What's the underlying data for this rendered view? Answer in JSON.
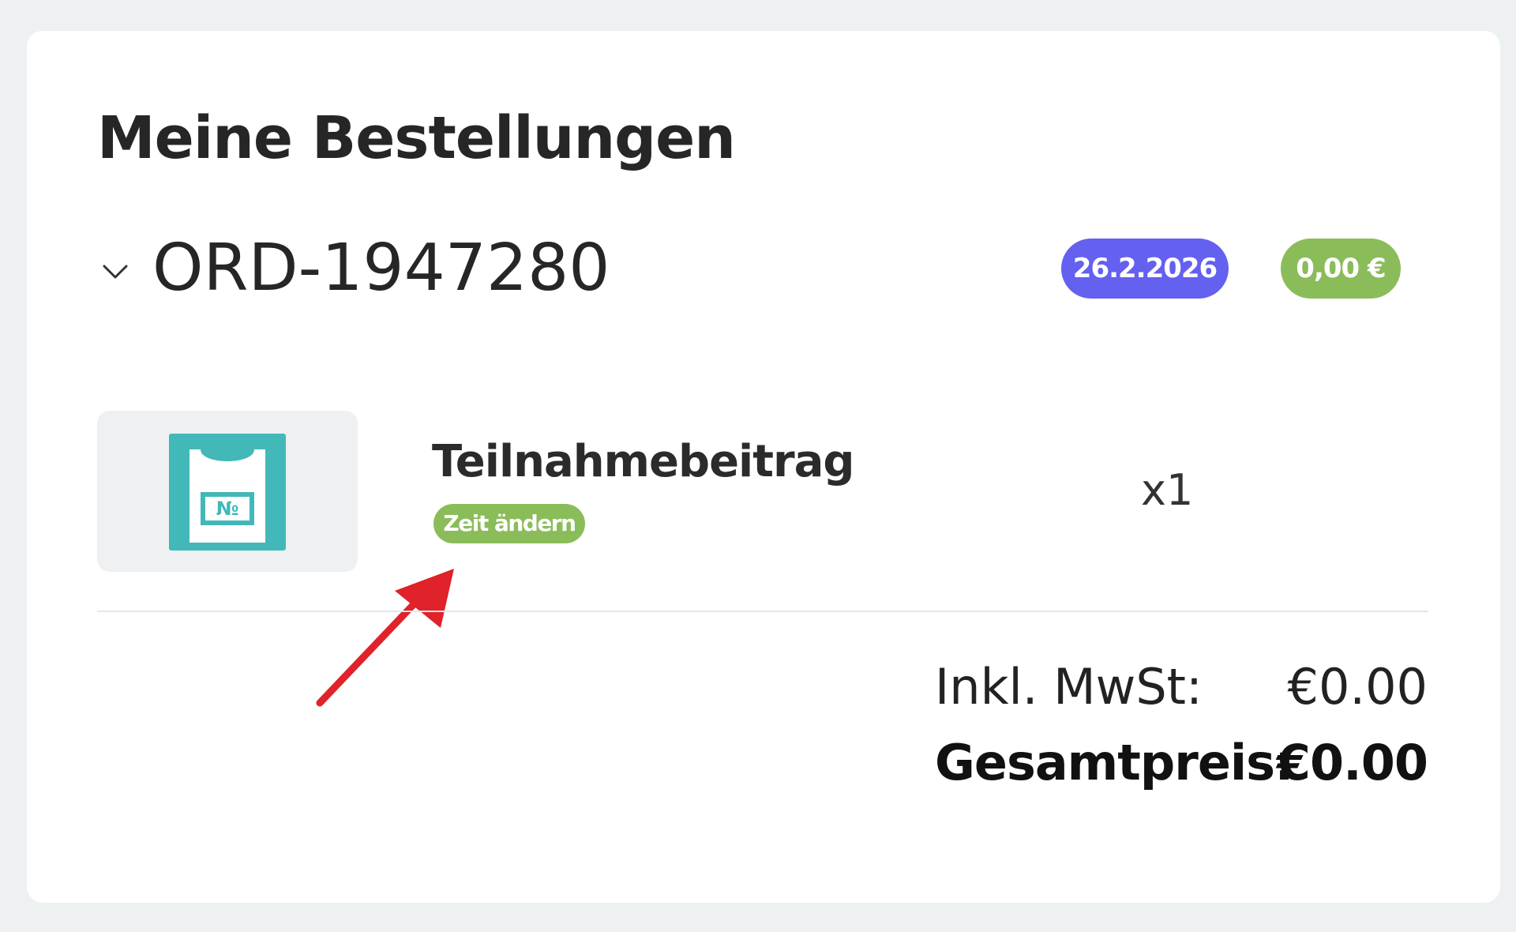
{
  "page": {
    "title": "Meine Bestellungen"
  },
  "colors": {
    "background": "#eef1f2",
    "card": "#ffffff",
    "date_badge": "#6460f0",
    "price_badge": "#8bbc5a",
    "tag": "#8bbc5a",
    "product_icon": "#42b8b8",
    "annotation_arrow": "#e0222a"
  },
  "order": {
    "id": "ORD-1947280",
    "date_badge": "26.2.2026",
    "price_badge": "0,00 €",
    "expand_icon": "chevron-down-icon",
    "items": [
      {
        "name": "Teilnahmebeitrag",
        "action_label": "Zeit ändern",
        "quantity": "x1",
        "icon": "race-bib-shirt-icon"
      }
    ],
    "totals": {
      "tax_label": "Inkl. MwSt:",
      "tax_value": "€0.00",
      "grand_label": "Gesamtpreis:",
      "grand_value": "€0.00"
    }
  },
  "annotation": {
    "icon": "arrow-pointer-icon"
  }
}
